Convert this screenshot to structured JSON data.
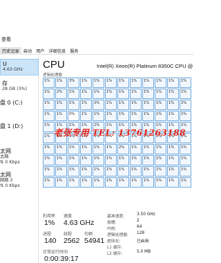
{
  "menu": {
    "view_label": "查看"
  },
  "tabs": [
    "历史记录",
    "启动",
    "用户",
    "详细信息",
    "服务"
  ],
  "sidebar": {
    "items": [
      {
        "title": "U",
        "subtitle": "4.63 GHz"
      },
      {
        "title": "存",
        "subtitle": "28 GB (3%)"
      },
      {
        "title": "盘 0 (C:)",
        "subtitle": ""
      },
      {
        "title": "盘 1 (D:)",
        "subtitle": ""
      },
      {
        "title": "太网",
        "subtitle": "太网",
        "extra": "0 Kbps"
      },
      {
        "title": "太网",
        "subtitle": "网络 2",
        "extra": "0 Kbps"
      }
    ]
  },
  "main": {
    "title": "CPU",
    "model": "Intel(R) Xeon(R) Platinum 8350C CPU @",
    "grid_label": "逻辑处理器",
    "cells": [
      [
        "1%",
        "1%",
        "3%",
        "1%",
        "1%",
        "1%",
        "1%",
        "1%",
        "1%",
        "1%",
        "1%",
        "1%"
      ],
      [
        "1%",
        "2%",
        "1%",
        "1%",
        "1%",
        "1%",
        "1%",
        "1%",
        "1%",
        "1%",
        "1%",
        "1%"
      ],
      [
        "1%",
        "1%",
        "1%",
        "1%",
        "2%",
        "1%",
        "1%",
        "1%",
        "1%",
        "1%",
        "1%",
        "2%"
      ],
      [
        "1%",
        "1%",
        "0%",
        "1%",
        "1%",
        "1%",
        "1%",
        "1%",
        "1%",
        "1%",
        "1%",
        "1%"
      ],
      [
        "1%",
        "1%",
        "1%",
        "1%",
        "2%",
        "1%",
        "1%",
        "1%",
        "1%",
        "1%",
        "1%",
        "1%"
      ],
      [
        "1%",
        "1%",
        "1%",
        "1%",
        "1%",
        "0%",
        "1%",
        "1%",
        "2%",
        "1%",
        "1%",
        "1%"
      ],
      [
        "1%",
        "1%",
        "1%",
        "1%",
        "1%",
        "1%",
        "2%",
        "1%",
        "1%",
        "1%",
        "1%",
        "1%"
      ],
      [
        "1%",
        "1%",
        "1%",
        "1%",
        "1%",
        "1%",
        "1%",
        "1%",
        "1%",
        "1%",
        "1%",
        "1%"
      ],
      [
        "1%",
        "1%",
        "1%",
        "1%",
        "1%",
        "1%",
        "1%",
        "1%",
        "1%",
        "1%",
        "1%",
        "1%"
      ],
      [
        "1%",
        "1%",
        "1%",
        "1%",
        "1%",
        "1%",
        "1%",
        "1%",
        "1%",
        "1%",
        "1%",
        "1%"
      ]
    ],
    "stats": {
      "utilization_label": "利用率",
      "utilization": "1%",
      "speed_label": "速度",
      "speed": "4.63 GHz",
      "processes_label": "进程",
      "processes": "140",
      "threads_label": "线程",
      "threads": "2562",
      "handles_label": "句柄",
      "handles": "54941",
      "uptime_label": "正常运行时间",
      "uptime": "0:00:39:17"
    },
    "kv": [
      {
        "k": "基准速度:",
        "v": "3.50 GHz"
      },
      {
        "k": "插槽:",
        "v": "2"
      },
      {
        "k": "内核:",
        "v": "64"
      },
      {
        "k": "逻辑处理器:",
        "v": "128"
      },
      {
        "k": "虚拟化:",
        "v": "已启用"
      },
      {
        "k": "L1 缓存:",
        "v": ""
      },
      {
        "k": "L2 缓存:",
        "v": "5.0 MB"
      }
    ]
  },
  "watermark": "老张专用 TEL: 13761263188",
  "colors": {
    "cell_border": "#6fa8dc",
    "selected": "#cce4f7",
    "watermark": "#e6271d"
  }
}
